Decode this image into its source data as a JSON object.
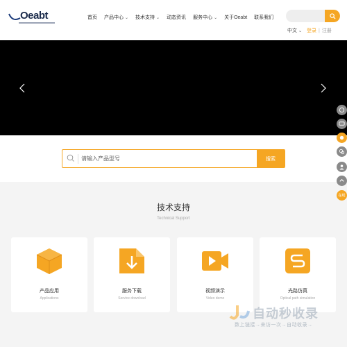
{
  "header": {
    "logo_text": "Oeabt",
    "nav": [
      {
        "label": "首页",
        "dropdown": false
      },
      {
        "label": "产品中心",
        "dropdown": true
      },
      {
        "label": "技术支持",
        "dropdown": true
      },
      {
        "label": "动态资讯",
        "dropdown": false
      },
      {
        "label": "服务中心",
        "dropdown": true
      },
      {
        "label": "关于Oeabt",
        "dropdown": false
      },
      {
        "label": "联系我们",
        "dropdown": false
      }
    ],
    "language": "中文",
    "login": "登录",
    "separator": "|",
    "register": "注册"
  },
  "product_search": {
    "placeholder": "请输入产品型号",
    "button": "搜索"
  },
  "support": {
    "title": "技术支持",
    "subtitle": "Technical Support",
    "cards": [
      {
        "label": "产品应用",
        "sub": "Applications",
        "icon": "cube-icon"
      },
      {
        "label": "服务下载",
        "sub": "Service download",
        "icon": "download-icon"
      },
      {
        "label": "视频演示",
        "sub": "Video demo",
        "icon": "video-icon"
      },
      {
        "label": "光路仿真",
        "sub": "Optical path simulation",
        "icon": "simulation-icon"
      }
    ]
  },
  "float_bar": {
    "top_label": "TOP",
    "service_label": "在线"
  },
  "watermark": {
    "main": "自动秒收录",
    "sub": "数上链接→来访一次→自动收录→"
  },
  "colors": {
    "accent": "#f5a623",
    "banner": "#000000",
    "section_bg": "#f4f4f4"
  }
}
